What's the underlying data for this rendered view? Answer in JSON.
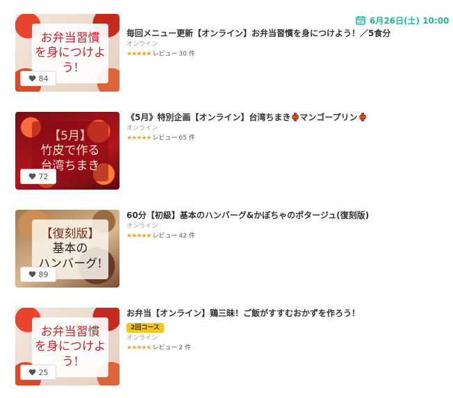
{
  "header": {
    "date": "6月26日(土) 10:00",
    "calendar_icon": "calendar-icon",
    "accent": "#1fb89a"
  },
  "items": [
    {
      "thumb_lines": [
        "お弁当習慣",
        "を身につけよう!"
      ],
      "likes": "84",
      "title": "毎回メニュー更新【オンライン】お弁当習慣を身につけよう！／5食分",
      "category": "オンライン",
      "stars": "★★★★★",
      "review_label": "レビュー",
      "review_count": "30",
      "review_unit": "件"
    },
    {
      "thumb_lines": [
        "【5月】",
        "竹皮で作る",
        "台湾ちまき"
      ],
      "likes": "72",
      "title_parts": [
        "《5月》特別企画【オンライン】台湾ちまき",
        "マンゴープリン"
      ],
      "category": "オンライン",
      "stars": "★★★★★",
      "review_label": "レビュー",
      "review_count": "65",
      "review_unit": "件"
    },
    {
      "thumb_lines": [
        "【復刻版】",
        "基本の",
        "ハンバーグ!"
      ],
      "likes": "89",
      "title": "60分【初級】基本のハンバーグ&かぼちゃのポタージュ(復刻版)",
      "category": "オンライン",
      "stars": "★★★★★",
      "review_label": "レビュー",
      "review_count": "42",
      "review_unit": "件"
    },
    {
      "thumb_lines": [
        "お弁当習慣",
        "を身につけよう!"
      ],
      "likes": "25",
      "title": "お弁当【オンライン】鶏三昧！ご飯がすすむおかずを作ろう！",
      "badge": "2回コース",
      "category": "オンライン",
      "stars": "★★★★★",
      "review_label": "レビュー",
      "review_count": "2",
      "review_unit": "件"
    }
  ],
  "colors": {
    "star": "#f5a623",
    "badge": "#f5c517",
    "lantern": "#d0281c"
  }
}
